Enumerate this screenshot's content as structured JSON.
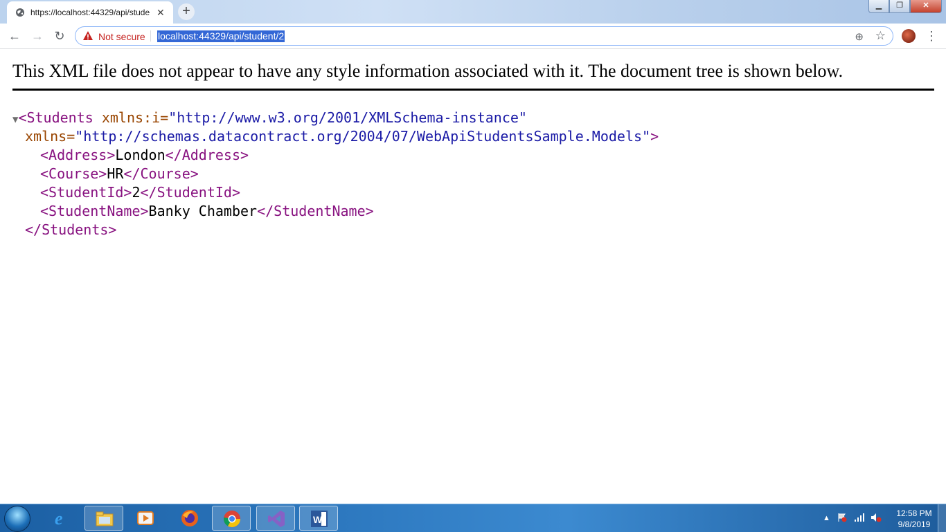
{
  "tab": {
    "title": "https://localhost:44329/api/stude",
    "close": "✕",
    "new_tab": "+"
  },
  "window": {
    "minimize": "▁",
    "maximize": "❐",
    "close": "✕"
  },
  "toolbar": {
    "back": "←",
    "forward": "→",
    "reload": "↻",
    "security_label": "Not secure",
    "url": "localhost:44329/api/student/2",
    "zoom": "⊕",
    "bookmark": "☆",
    "menu": "⋮"
  },
  "page": {
    "banner": "This XML file does not appear to have any style information associated with it. The document tree is shown below.",
    "xml": {
      "root_open_tag": "<Students",
      "attr1_name": " xmlns:i=",
      "attr1_value": "\"http://www.w3.org/2001/XMLSchema-instance\"",
      "attr2_name": "xmlns=",
      "attr2_value": "\"http://schemas.datacontract.org/2004/07/WebApiStudentsSample.Models\"",
      "root_open_close": ">",
      "address_open": "<Address>",
      "address": "London",
      "address_close": "</Address>",
      "course_open": "<Course>",
      "course": "HR",
      "course_close": "</Course>",
      "studentid_open": "<StudentId>",
      "studentid": "2",
      "studentid_close": "</StudentId>",
      "studentname_open": "<StudentName>",
      "studentname": "Banky Chamber",
      "studentname_close": "</StudentName>",
      "root_close_tag": "</Students>"
    }
  },
  "taskbar": {
    "time": "12:58 PM",
    "date": "9/8/2019",
    "apps": [
      "windows-explorer",
      "media-player",
      "firefox",
      "chrome",
      "visual-studio",
      "word"
    ]
  },
  "colors": {
    "xml_tag": "#881280",
    "xml_attr": "#994500",
    "xml_value": "#1a1aa6",
    "url_highlight": "#3367d6",
    "not_secure": "#c5221f"
  }
}
